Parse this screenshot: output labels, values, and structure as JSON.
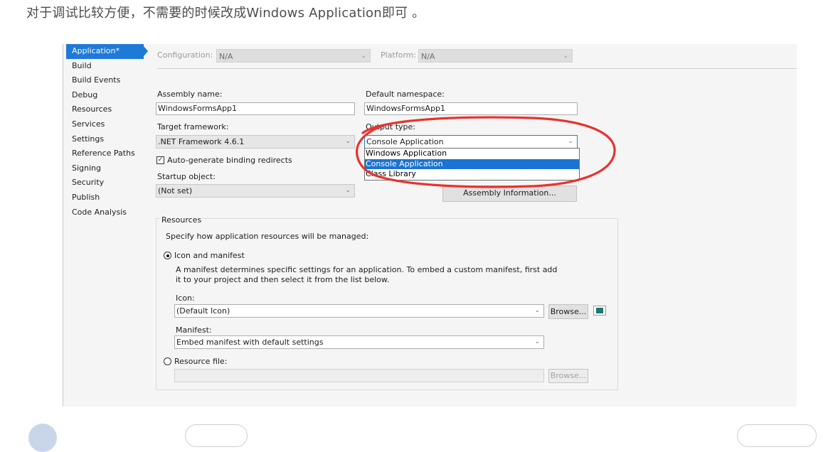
{
  "caption": "对于调试比较方便，不需要的时候改成Windows Application即可 。",
  "nav": {
    "items": [
      "Application*",
      "Build",
      "Build Events",
      "Debug",
      "Resources",
      "Services",
      "Settings",
      "Reference Paths",
      "Signing",
      "Security",
      "Publish",
      "Code Analysis"
    ],
    "active": "Application*"
  },
  "config": {
    "configuration_label": "Configuration:",
    "configuration_value": "N/A",
    "platform_label": "Platform:",
    "platform_value": "N/A"
  },
  "form": {
    "assembly_name_label": "Assembly name:",
    "assembly_name_value": "WindowsFormsApp1",
    "default_namespace_label": "Default namespace:",
    "default_namespace_value": "WindowsFormsApp1",
    "target_framework_label": "Target framework:",
    "target_framework_value": ".NET Framework 4.6.1",
    "output_type_label": "Output type:",
    "output_type_value": "Console Application",
    "output_type_options": [
      "Windows Application",
      "Console Application",
      "Class Library"
    ],
    "output_type_selected_index": 1,
    "auto_binding_label": "Auto-generate binding redirects",
    "auto_binding_checked": true,
    "startup_object_label": "Startup object:",
    "startup_object_value": "(Not set)",
    "assembly_info_button": "Assembly Information..."
  },
  "resources": {
    "group_title": "Resources",
    "description": "Specify how application resources will be managed:",
    "icon_manifest_label": "Icon and manifest",
    "icon_manifest_selected": true,
    "manifest_desc_line1": "A manifest determines specific settings for an application. To embed a custom manifest, first add",
    "manifest_desc_line2": "it to your project and then select it from the list below.",
    "icon_label": "Icon:",
    "icon_value": "(Default Icon)",
    "browse_label": "Browse...",
    "manifest_label": "Manifest:",
    "manifest_value": "Embed manifest with default settings",
    "resource_file_label": "Resource file:",
    "resource_file_value": "",
    "resource_browse_label": "Browse..."
  },
  "colors": {
    "accent": "#1e7ad8",
    "annotation": "#e8322e"
  }
}
